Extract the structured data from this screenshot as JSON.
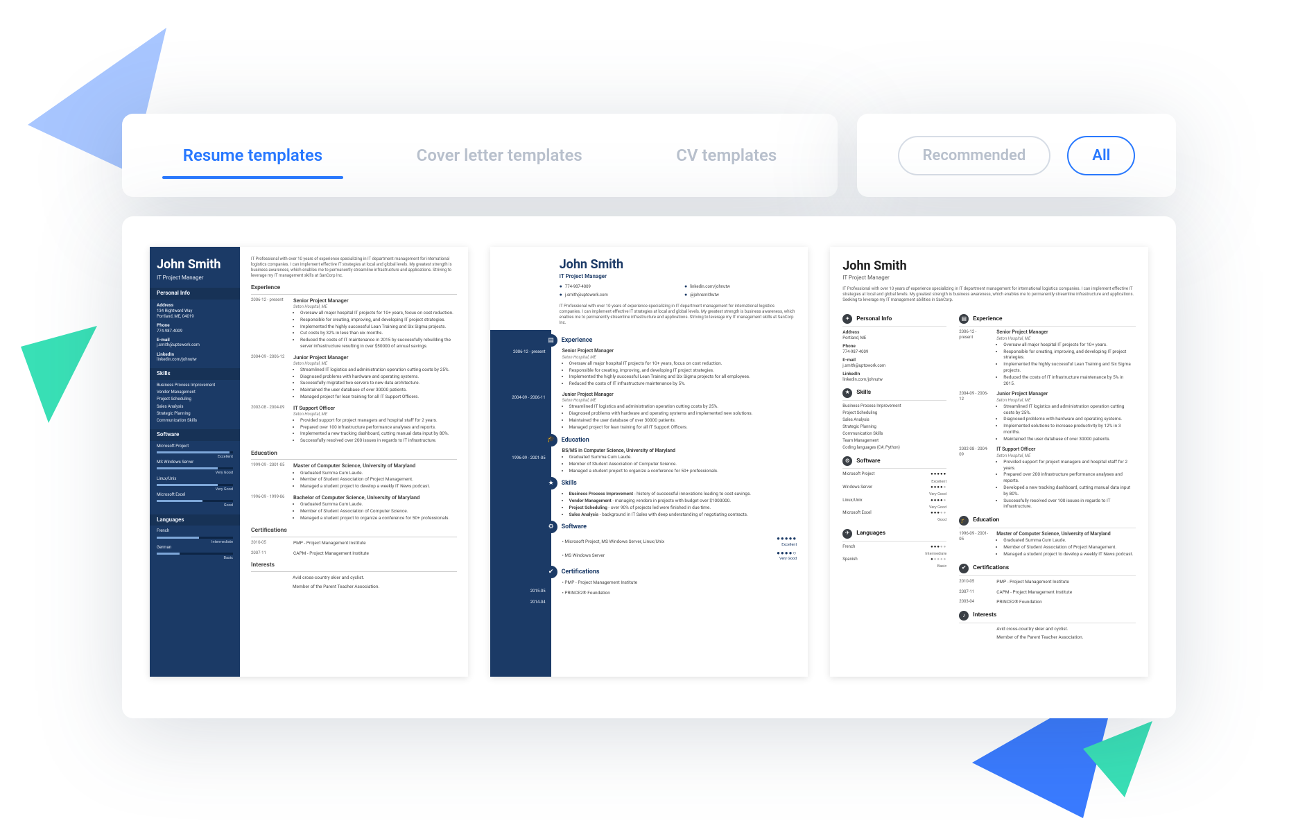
{
  "tabs": {
    "items": [
      {
        "label": "Resume templates",
        "active": true
      },
      {
        "label": "Cover letter templates",
        "active": false
      },
      {
        "label": "CV templates",
        "active": false
      }
    ]
  },
  "filters": {
    "recommended": "Recommended",
    "all": "All",
    "active": "all"
  },
  "person": {
    "name": "John Smith",
    "role": "IT Project Manager"
  },
  "summary": "IT Professional with over 10 years of experience specializing in IT department management for international logistics companies. I can implement effective IT strategies at local and global levels. My greatest strength is business awareness, which enables me to permanently streamline infrastructure and applications. Striving to leverage my IT management skills at SanCorp Inc.",
  "summary_c": "IT Professional with over 10 years of experience specializing in IT department management for international logistics companies. I can implement effective IT strategies at local and global levels. My greatest strength is business awareness, which enables me to permanently streamline infrastructure and applications. Seeking to leverage my IT management abilities in SanCorp.",
  "contact": {
    "address_label": "Address",
    "address": "134 Rightward Way\nPortland, ME, 04019",
    "address_short": "Portland, ME",
    "phone_label": "Phone",
    "phone": "774-987-4009",
    "email_label": "E-mail",
    "email": "j.smith@uptowork.com",
    "linkedin_label": "LinkedIn",
    "linkedin": "linkedin.com/johnutw",
    "twitter": "@johnsmithutw"
  },
  "sections": {
    "personal": "Personal Info",
    "skills": "Skills",
    "software": "Software",
    "languages": "Languages",
    "experience": "Experience",
    "education": "Education",
    "certifications": "Certifications",
    "interests": "Interests"
  },
  "skills": [
    "Business Process Improvement",
    "Vendor Management",
    "Project Scheduling",
    "Sales Analysis",
    "Strategic Planning",
    "Communication Skills"
  ],
  "skills_c_extra": [
    "Team Management",
    "Coding languages (C#, Python)"
  ],
  "software": [
    {
      "name": "Microsoft Project",
      "level": "Excellent",
      "pct": 95
    },
    {
      "name": "MS Windows Server",
      "level": "Very Good",
      "pct": 80
    },
    {
      "name": "Linux/Unix",
      "level": "Very Good",
      "pct": 80
    },
    {
      "name": "Microsoft Excel",
      "level": "Good",
      "pct": 60
    }
  ],
  "software_c": [
    {
      "name": "Microsoft Project",
      "dots": 5,
      "level": "Excellent"
    },
    {
      "name": "Windows Server",
      "dots": 4,
      "level": "Very Good"
    },
    {
      "name": "Linux/Unix",
      "dots": 4,
      "level": "Very Good"
    },
    {
      "name": "Microsoft Excel",
      "dots": 3,
      "level": "Good"
    }
  ],
  "languages": [
    {
      "name": "French",
      "level": "Intermediate",
      "pct": 55
    },
    {
      "name": "German",
      "level": "Basic",
      "pct": 30
    }
  ],
  "languages_c": [
    {
      "name": "French",
      "dots": 3,
      "level": "Intermediate"
    },
    {
      "name": "Spanish",
      "dots": 1,
      "level": "Basic"
    }
  ],
  "experience": [
    {
      "dates": "2006-12 - present",
      "title": "Senior Project Manager",
      "org": "Seton Hospital, ME",
      "bullets": [
        "Oversaw all major hospital IT projects for 10+ years, focus on cost reduction.",
        "Responsible for creating, improving, and developing IT project strategies.",
        "Implemented the highly successful Lean Training and Six Sigma projects.",
        "Cut costs by 32% in less than six months.",
        "Reduced the costs of IT maintenance in 2015 by successfully rebuilding the server infrastructure resulting in over $50000 of annual savings."
      ]
    },
    {
      "dates": "2004-09 - 2006-12",
      "title": "Junior Project Manager",
      "org": "Seton Hospital, ME",
      "bullets": [
        "Streamlined IT logistics and administration operation cutting costs by 25%.",
        "Diagnosed problems with hardware and operating systems.",
        "Successfully migrated two servers to new data architecture.",
        "Maintained the user database of over 30000 patients.",
        "Managed project for lean training for all IT Support Officers."
      ]
    },
    {
      "dates": "2002-08 - 2004-09",
      "title": "IT Support Officer",
      "org": "Seton Hospital, ME",
      "bullets": [
        "Provided support for project managers and hospital staff for 2 years.",
        "Prepared over 100 infrastructure performance analyses and reports.",
        "Implemented a new tracking dashboard, cutting manual data input by 80%.",
        "Successfully resolved over 200 issues in regards to IT infrastructure."
      ]
    }
  ],
  "experience_b": [
    {
      "dates": "2006-12 - present",
      "title": "Senior Project Manager",
      "org": "Seton Hospital, ME",
      "bullets": [
        "Oversaw all major hospital IT projects for 10+ years, focus on cost reduction.",
        "Responsible for creating, improving, and developing IT project strategies.",
        "Implemented the highly successful Lean Training and Six Sigma projects for all employees.",
        "Reduced the costs of IT infrastructure maintenance by 5%."
      ]
    },
    {
      "dates": "2004-09 - 2006-11",
      "title": "Junior Project Manager",
      "org": "Seton Hospital, ME",
      "bullets": [
        "Streamlined IT logistics and administration operation cutting costs by 25%.",
        "Diagnosed problems with hardware and operating systems and implemented new solutions.",
        "Maintained the user database of over 30000 patients.",
        "Managed project for lean training for all IT Support Officers."
      ]
    }
  ],
  "experience_c": [
    {
      "dates": "2006-12 - present",
      "title": "Senior Project Manager",
      "org": "Seton Hospital, ME",
      "bullets": [
        "Oversaw all major hospital IT projects for 10+ years.",
        "Responsible for creating, improving, and developing IT project strategies.",
        "Implemented the highly successful Lean Training and Six Sigma projects.",
        "Reduced the costs of IT infrastructure maintenance by 5% in 2015."
      ]
    },
    {
      "dates": "2004-09 - 2006-12",
      "title": "Junior Project Manager",
      "org": "Seton Hospital, ME",
      "bullets": [
        "Streamlined IT logistics and administration operation cutting costs by 25%.",
        "Diagnosed problems with hardware and operating systems.",
        "Implemented solutions to increase productivity by 12% in 3 months.",
        "Maintained the user database of over 30000 patients."
      ]
    },
    {
      "dates": "2002-08 - 2004-09",
      "title": "IT Support Officer",
      "org": "Seton Hospital, ME",
      "bullets": [
        "Provided support for project managers and hospital staff for 2 years.",
        "Prepared over 200 infrastructure performance analyses and reports.",
        "Developed a new tracking dashboard, cutting manual data input by 80%.",
        "Successfully resolved over 100 issues in regards to IT infrastructure."
      ]
    }
  ],
  "education": [
    {
      "dates": "1999-09 - 2001-05",
      "title": "Master of Computer Science, University of Maryland",
      "bullets": [
        "Graduated Summa Cum Laude.",
        "Member of Student Association of Project Management.",
        "Managed a student project to develop a weekly IT News podcast."
      ]
    },
    {
      "dates": "1996-09 - 1999-06",
      "title": "Bachelor of Computer Science, University of Maryland",
      "bullets": [
        "Graduated Summa Cum Laude.",
        "Member of Student Association of Computer Science.",
        "Managed a student project to organize a conference for 50+ professionals."
      ]
    }
  ],
  "education_b": {
    "dates": "1996-09 - 2001-05",
    "title": "BS/MS in Computer Science, University of Maryland",
    "bullets": [
      "Graduated Summa Cum Laude.",
      "Member of Student Association of Computer Science.",
      "Managed a student project to organize a conference for 50+ professionals."
    ]
  },
  "education_c": {
    "dates": "1996-09 - 2001-05",
    "title": "Master of Computer Science, University of Maryland",
    "bullets": [
      "Graduated Summa Cum Laude.",
      "Member of Student Association of Project Management.",
      "Managed a student project to develop a weekly IT News podcast."
    ]
  },
  "skills_b": [
    {
      "name": "Business Process Improvement",
      "desc": "history of successful innovations leading to cost savings."
    },
    {
      "name": "Vendor Management",
      "desc": "managing vendors in projects with budget over $1000000."
    },
    {
      "name": "Project Scheduling",
      "desc": "over 90% of projects led were finished in due time."
    },
    {
      "name": "Sales Analysis",
      "desc": "background in IT Sales with deep understanding of negotiating contracts."
    }
  ],
  "software_b": [
    {
      "name": "Microsoft Project, MS Windows Server, Linux/Unix",
      "dots": 5,
      "level": "Excellent"
    },
    {
      "name": "MS Windows Server",
      "dots": 4,
      "level": "Very Good"
    }
  ],
  "certifications": [
    {
      "date": "2010-05",
      "name": "PMP - Project Management Institute"
    },
    {
      "date": "2007-11",
      "name": "CAPM - Project Management Institute"
    }
  ],
  "certifications_b": [
    {
      "date": "2015-05",
      "name": "PMP - Project Management Institute"
    },
    {
      "date": "2014-04",
      "name": "PRINCE2® Foundation"
    }
  ],
  "certifications_c": [
    {
      "date": "2010-05",
      "name": "PMP - Project Management Institute"
    },
    {
      "date": "2007-11",
      "name": "CAPM - Project Management Institute"
    },
    {
      "date": "2003-04",
      "name": "PRINCE2® Foundation"
    }
  ],
  "interests": [
    "Avid cross-country skier and cyclist.",
    "Member of the Parent Teacher Association."
  ]
}
